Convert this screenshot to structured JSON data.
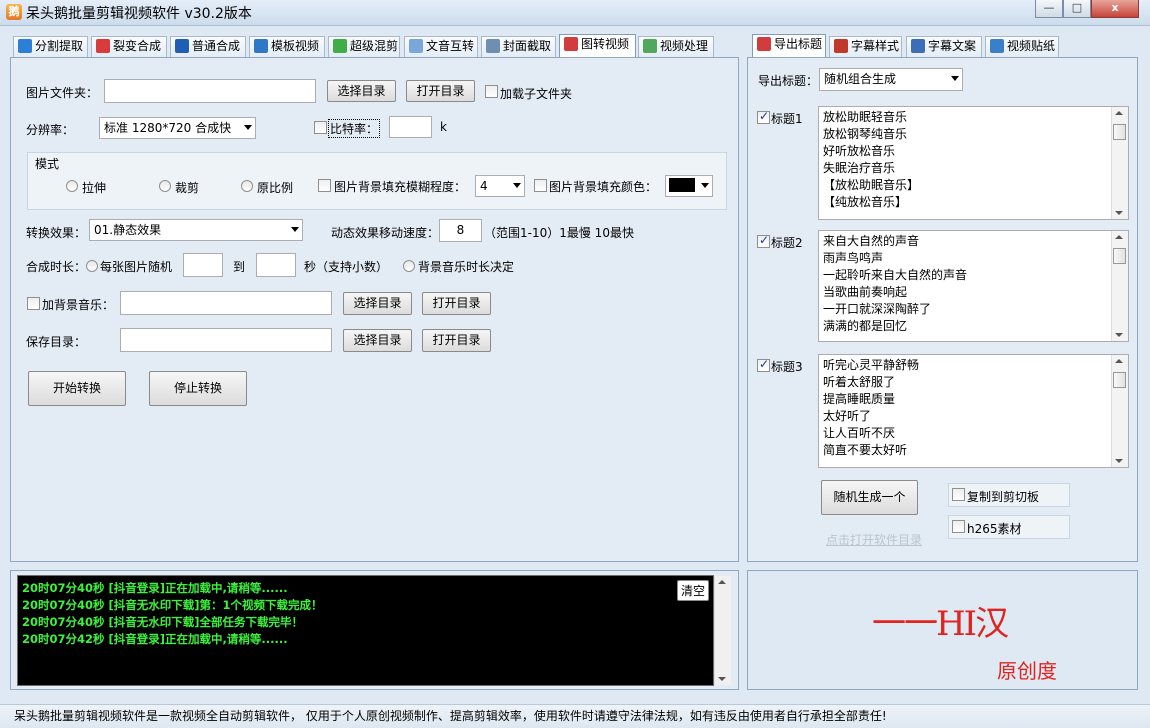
{
  "window": {
    "title": "呆头鹅批量剪辑视频软件   v30.2版本",
    "min_label": "—",
    "max_label": "□",
    "close_label": "x"
  },
  "tabs": [
    {
      "label": "分割提取",
      "icon_color": "#2c7fd6"
    },
    {
      "label": "裂变合成",
      "icon_color": "#d83b3b"
    },
    {
      "label": "普通合成",
      "icon_color": "#1e5fb5"
    },
    {
      "label": "模板视频",
      "icon_color": "#2f78c8"
    },
    {
      "label": "超级混剪",
      "icon_color": "#3fae49"
    },
    {
      "label": "文音互转",
      "icon_color": "#7aa7d9"
    },
    {
      "label": "封面截取",
      "icon_color": "#6f8fb0"
    },
    {
      "label": "图转视频",
      "icon_color": "#d13c3c"
    },
    {
      "label": "视频处理",
      "icon_color": "#52a85a"
    }
  ],
  "form": {
    "folder_label": "图片文件夹：",
    "folder_value": "",
    "choose_dir": "选择目录",
    "open_dir": "打开目录",
    "load_sub": "加载子文件夹",
    "resolution_label": "分辨率：",
    "resolution_value": "标准 1280*720 合成快",
    "bitrate_label": "比特率：",
    "bitrate_value": "",
    "bitrate_unit": "k",
    "mode_title": "模式",
    "mode_stretch": "拉伸",
    "mode_crop": "裁剪",
    "mode_original": "原比例",
    "blur_label": "图片背景填充模糊程度：",
    "blur_value": "4",
    "fill_color_label": "图片背景填充颜色：",
    "fill_color": "#000000",
    "effect_label": "转换效果：",
    "effect_value": "01.静态效果",
    "speed_label": "动态效果移动速度：",
    "speed_value": "8",
    "speed_hint": "（范围1-10）1最慢 10最快",
    "duration_label": "合成时长：",
    "duration_random": "每张图片随机",
    "duration_to": "到",
    "duration_unit": "秒（支持小数）",
    "duration_bgm": "背景音乐时长决定",
    "bgm_label": "加背景音乐：",
    "bgm_value": "",
    "save_label": "保存目录：",
    "save_value": "",
    "start": "开始转换",
    "stop": "停止转换"
  },
  "right_tabs": [
    {
      "label": "导出标题",
      "icon_color": "#d23c3c"
    },
    {
      "label": "字幕样式",
      "icon_color": "#c0392b"
    },
    {
      "label": "字幕文案",
      "icon_color": "#3a6fb7"
    },
    {
      "label": "视频贴纸",
      "icon_color": "#3a80c8"
    }
  ],
  "export": {
    "label": "导出标题：",
    "mode": "随机组合生成",
    "title1": {
      "label": "标题1",
      "lines": [
        "放松助眠轻音乐",
        "放松钢琴纯音乐",
        "好听放松音乐",
        "失眠治疗音乐",
        "【放松助眠音乐】",
        "【纯放松音乐】"
      ]
    },
    "title2": {
      "label": "标题2",
      "lines": [
        "来自大自然的声音",
        "雨声鸟鸣声",
        "一起聆听来自大自然的声音",
        "当歌曲前奏响起",
        "一开口就深深陶醉了",
        "满满的都是回忆"
      ]
    },
    "title3": {
      "label": "标题3",
      "lines": [
        "听完心灵平静舒畅",
        "听着太舒服了",
        "提高睡眠质量",
        "太好听了",
        "让人百听不厌",
        "简直不要太好听"
      ]
    },
    "generate": "随机生成一个",
    "copy_clip": "复制到剪切板",
    "h265": "h265素材",
    "open_dir_link": "点击打开软件目录"
  },
  "log": {
    "clear": "清空",
    "lines": [
      "20时07分40秒 [抖音登录]正在加载中,请稍等......",
      "20时07分40秒 [抖音无水印下载]第：1个视频下载完成！",
      "20时07分40秒 [抖音无水印下载]全部任务下载完毕！",
      "20时07分42秒 [抖音登录]正在加载中,请稍等......"
    ]
  },
  "brand": {
    "text_top": "一一HI汉",
    "text_bottom": "原创度",
    "color": "#e0241f"
  },
  "status": "呆头鹅批量剪辑视频软件是一款视频全自动剪辑软件， 仅用于个人原创视频制作、提高剪辑效率，使用软件时请遵守法律法规，如有违反由使用者自行承担全部责任!"
}
